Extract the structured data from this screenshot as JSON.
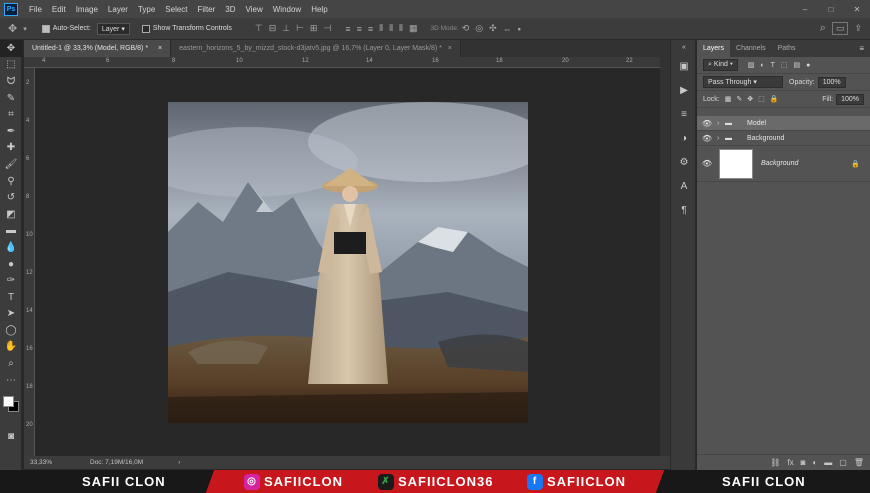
{
  "app": {
    "logo": "Ps"
  },
  "menu": [
    "File",
    "Edit",
    "Image",
    "Layer",
    "Type",
    "Select",
    "Filter",
    "3D",
    "View",
    "Window",
    "Help"
  ],
  "window_controls": [
    "–",
    "□",
    "✕"
  ],
  "options": {
    "auto_select_label": "Auto-Select:",
    "auto_select_value": "Layer",
    "transform_label": "Show Transform Controls",
    "mode_3d_label": "3D Mode:"
  },
  "tabs": [
    {
      "label": "Untitled-1 @ 33,3% (Model, RGB/8) *",
      "close": "×"
    },
    {
      "label": "eastern_horizons_5_by_mizzd_stock-d3jatv5.jpg @ 16,7% (Layer 0, Layer Mask/8) *",
      "close": "×"
    }
  ],
  "ruler_top": [
    "4",
    "6",
    "8",
    "10",
    "12",
    "14",
    "16",
    "18",
    "20",
    "22"
  ],
  "ruler_left": [
    "2",
    "4",
    "6",
    "8",
    "10",
    "12",
    "14",
    "16",
    "18",
    "20"
  ],
  "status": {
    "zoom": "33,33%",
    "doc": "Doc: 7,19M/16,0M",
    "arrow": "›"
  },
  "layers_panel": {
    "tabs": [
      "Layers",
      "Channels",
      "Paths"
    ],
    "kind_label": "Kind",
    "blend_mode": "Pass Through",
    "opacity_label": "Opacity:",
    "opacity_value": "100%",
    "lock_label": "Lock:",
    "fill_label": "Fill:",
    "fill_value": "100%",
    "layers": [
      {
        "name": "Model",
        "type": "group",
        "visible": true,
        "selected": true
      },
      {
        "name": "Background",
        "type": "group",
        "visible": true,
        "selected": false
      },
      {
        "name": "Background",
        "type": "pixel",
        "visible": true,
        "selected": false,
        "locked": true
      }
    ]
  },
  "banner": {
    "left_text": "SAFII CLON",
    "instagram": "SAFIICLON",
    "other": "SAFIICLON36",
    "facebook": "SAFIICLON",
    "right_text": "SAFII CLON"
  },
  "colors": {
    "accent": "#31a8ff",
    "banner_red": "#c8161d",
    "instagram": "#d6249f",
    "facebook": "#1877f2",
    "green": "#3aa14a"
  }
}
